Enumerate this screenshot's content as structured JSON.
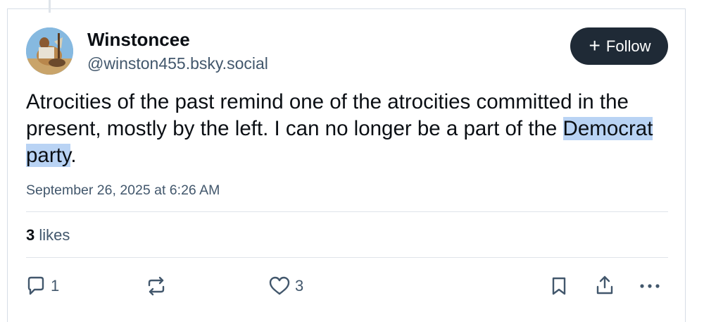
{
  "author": {
    "display_name": "Winstoncee",
    "handle": "@winston455.bsky.social"
  },
  "follow_button": {
    "label": "Follow",
    "icon": "plus-icon"
  },
  "post": {
    "text_before_highlight": "Atrocities of the past remind one of the atrocities committed in the present, mostly by the left. I can no longer be a part of the ",
    "highlighted_text": "Democrat party",
    "text_after_highlight": ".",
    "timestamp": "September 26, 2025 at 6:26 AM"
  },
  "likes": {
    "count": "3",
    "label": "likes"
  },
  "actions": {
    "reply": {
      "icon": "reply-icon",
      "count": "1"
    },
    "repost": {
      "icon": "repost-icon"
    },
    "like": {
      "icon": "heart-icon",
      "count": "3"
    },
    "bookmark": {
      "icon": "bookmark-icon"
    },
    "share": {
      "icon": "share-icon"
    },
    "more": {
      "icon": "more-icon"
    }
  },
  "colors": {
    "text_primary": "#0b0f14",
    "text_secondary": "#42576c",
    "follow_bg": "#1f2a36",
    "highlight": "#b9d3f4",
    "divider": "#dfe4ea"
  }
}
